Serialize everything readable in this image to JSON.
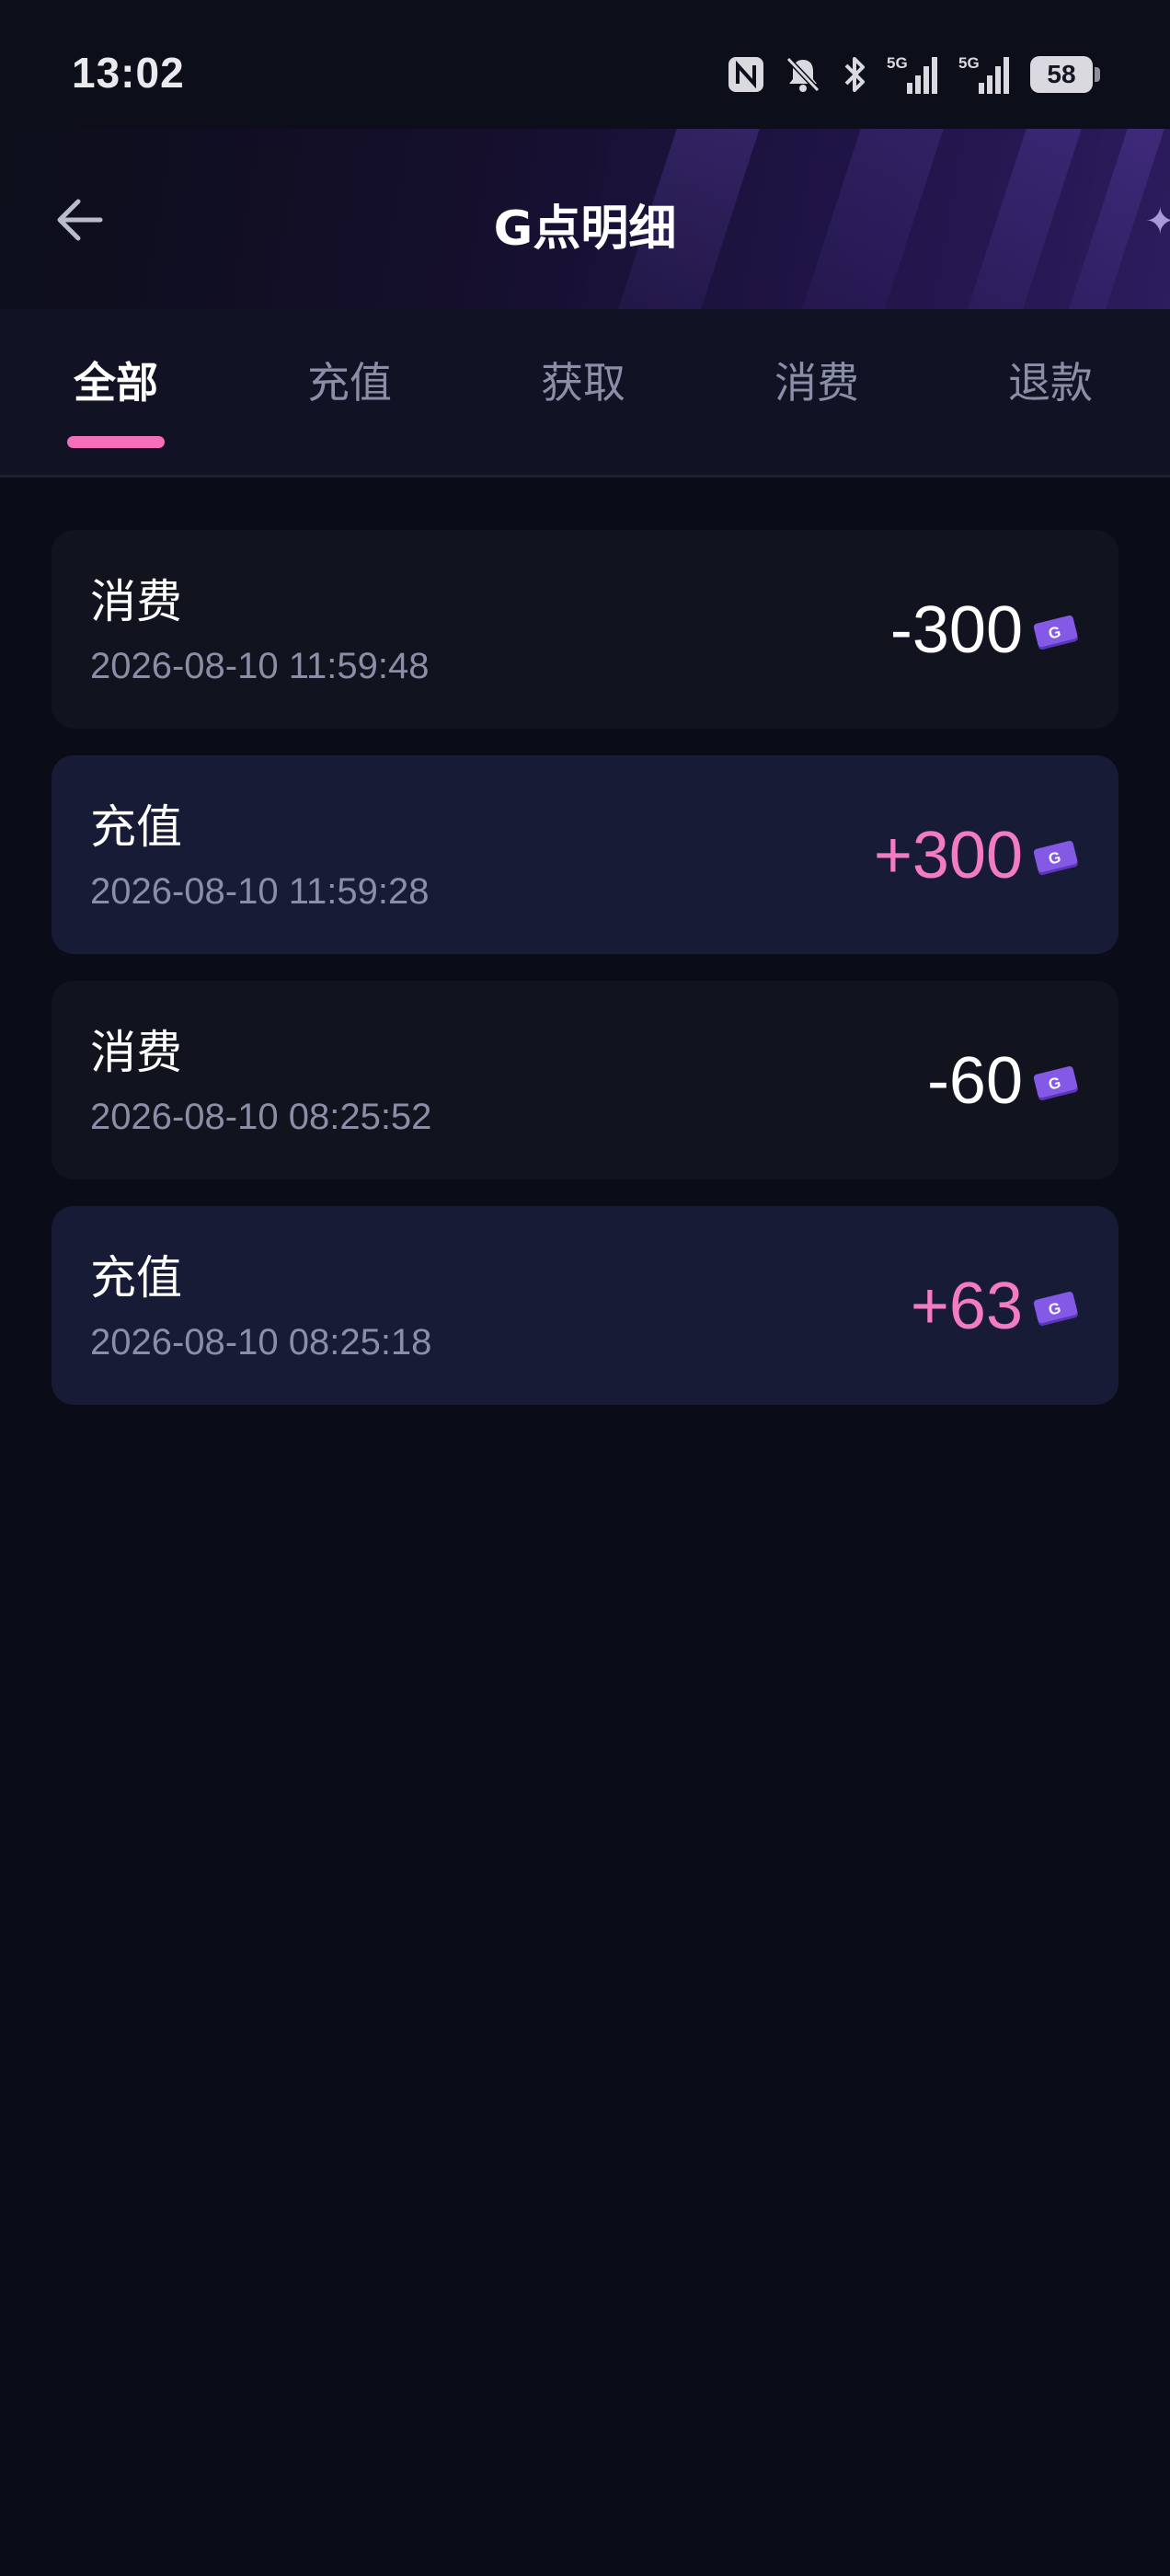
{
  "status_bar": {
    "time": "13:02",
    "battery": "58",
    "icons": [
      "nfc-icon",
      "bell-muted-icon",
      "bluetooth-icon",
      "signal-5g-icon",
      "signal-5g-icon",
      "battery-icon"
    ],
    "network_1": "5G",
    "network_2": "5G"
  },
  "header": {
    "title": "G点明细",
    "back_icon": "arrow-left-icon"
  },
  "tabs": [
    {
      "label": "全部",
      "active": true
    },
    {
      "label": "充值",
      "active": false
    },
    {
      "label": "获取",
      "active": false
    },
    {
      "label": "消费",
      "active": false
    },
    {
      "label": "退款",
      "active": false
    }
  ],
  "records": [
    {
      "type": "消费",
      "time": "2026-08-10 11:59:48",
      "amount": "-300",
      "positive": false
    },
    {
      "type": "充值",
      "time": "2026-08-10 11:59:28",
      "amount": "+300",
      "positive": true
    },
    {
      "type": "消费",
      "time": "2026-08-10 08:25:52",
      "amount": "-60",
      "positive": false
    },
    {
      "type": "充值",
      "time": "2026-08-10 08:25:18",
      "amount": "+63",
      "positive": true
    }
  ],
  "colors": {
    "background": "#0a0c17",
    "accent_pink": "#f46eb9",
    "positive_amount": "#f27bc4",
    "card_dark": "#11131f",
    "card_highlight": "#181b36",
    "muted_text": "#8a8ea6",
    "coin_purple": "#7a4fd6"
  },
  "coin_letter": "G"
}
